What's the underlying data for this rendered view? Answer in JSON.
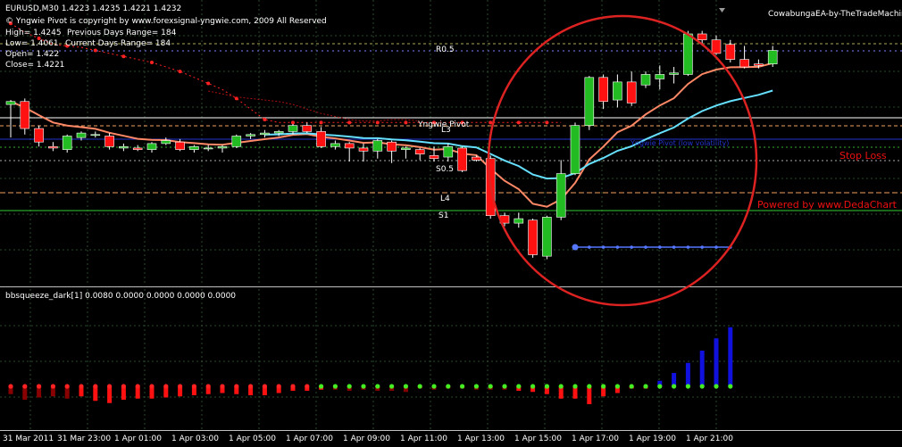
{
  "header": {
    "symbol_line": "EURUSD,M30  1.4223 1.4235 1.4221 1.4232",
    "copyright": "© Yngwie Pivot is copyright by www.forexsignal-yngwie.com, 2009 All Reserved",
    "high": "High= 1.4245",
    "prev_range": "Previous Days Range= 184",
    "low": "Low= 1.4061",
    "current_range": "Current Days Range= 184",
    "open": "Open= 1.422",
    "close": "Close= 1.4221"
  },
  "ea_label": "CowabungaEA-by-TheTradeMachine",
  "pivot_labels": {
    "r05": "R0.5",
    "yngwie_pivot": "Yngwie Pivot",
    "l3": "L3",
    "s05": "S0.5",
    "l4": "L4",
    "s1": "S1"
  },
  "annotations": {
    "stop_loss": "Stop Loss",
    "powered_by": "Powered by www.DedaChart",
    "blue_note": "Yngwie Pivot (low volatility)"
  },
  "indicator": {
    "label": "bbsqueeze_dark[1] 0.0080 0.0000 0.0000 0.0000 0.0000"
  },
  "time_axis": [
    "31 Mar 2011",
    "31 Mar 23:00",
    "1 Apr 01:00",
    "1 Apr 03:00",
    "1 Apr 05:00",
    "1 Apr 07:00",
    "1 Apr 09:00",
    "1 Apr 11:00",
    "1 Apr 13:00",
    "1 Apr 15:00",
    "1 Apr 17:00",
    "1 Apr 19:00",
    "1 Apr 21:00"
  ],
  "colors": {
    "bull": "#22bb22",
    "bear": "#ff1111",
    "squeeze_blue": "#1111dd",
    "squeeze_red": "#ff1111",
    "squeeze_darkred": "#880000",
    "ma_fast": "#ff8866",
    "ma_slow": "#66e0ff",
    "dots_red": "#ff2222",
    "dots_blue": "#5577ff",
    "circle": "#dd2222"
  },
  "chart_data": {
    "type": "candlestick",
    "candles": [
      {
        "o": 1.4196,
        "h": 1.4199,
        "l": 1.4174,
        "c": 1.4198
      },
      {
        "o": 1.4198,
        "h": 1.42,
        "l": 1.4176,
        "c": 1.418
      },
      {
        "o": 1.418,
        "h": 1.4182,
        "l": 1.4168,
        "c": 1.4171
      },
      {
        "o": 1.4168,
        "h": 1.4171,
        "l": 1.4165,
        "c": 1.4167
      },
      {
        "o": 1.4166,
        "h": 1.4176,
        "l": 1.4164,
        "c": 1.4175
      },
      {
        "o": 1.4174,
        "h": 1.4178,
        "l": 1.4172,
        "c": 1.4177
      },
      {
        "o": 1.4176,
        "h": 1.4178,
        "l": 1.4174,
        "c": 1.4176
      },
      {
        "o": 1.4175,
        "h": 1.4177,
        "l": 1.4166,
        "c": 1.4168
      },
      {
        "o": 1.4167,
        "h": 1.417,
        "l": 1.4165,
        "c": 1.4168
      },
      {
        "o": 1.4167,
        "h": 1.4169,
        "l": 1.4165,
        "c": 1.4166
      },
      {
        "o": 1.4166,
        "h": 1.4171,
        "l": 1.4164,
        "c": 1.417
      },
      {
        "o": 1.417,
        "h": 1.4174,
        "l": 1.4169,
        "c": 1.4172
      },
      {
        "o": 1.4171,
        "h": 1.4173,
        "l": 1.4165,
        "c": 1.4166
      },
      {
        "o": 1.4166,
        "h": 1.4169,
        "l": 1.4164,
        "c": 1.4168
      },
      {
        "o": 1.4167,
        "h": 1.4169,
        "l": 1.4165,
        "c": 1.4167
      },
      {
        "o": 1.4167,
        "h": 1.4169,
        "l": 1.4164,
        "c": 1.4168
      },
      {
        "o": 1.4168,
        "h": 1.4176,
        "l": 1.4167,
        "c": 1.4175
      },
      {
        "o": 1.4175,
        "h": 1.4177,
        "l": 1.4173,
        "c": 1.4176
      },
      {
        "o": 1.4176,
        "h": 1.4179,
        "l": 1.4174,
        "c": 1.4177
      },
      {
        "o": 1.4177,
        "h": 1.4179,
        "l": 1.4175,
        "c": 1.4178
      },
      {
        "o": 1.4178,
        "h": 1.4183,
        "l": 1.4176,
        "c": 1.4182
      },
      {
        "o": 1.4182,
        "h": 1.4184,
        "l": 1.4177,
        "c": 1.4178
      },
      {
        "o": 1.4178,
        "h": 1.4181,
        "l": 1.4167,
        "c": 1.4168
      },
      {
        "o": 1.4168,
        "h": 1.4172,
        "l": 1.4166,
        "c": 1.417
      },
      {
        "o": 1.417,
        "h": 1.4171,
        "l": 1.4158,
        "c": 1.4167
      },
      {
        "o": 1.4167,
        "h": 1.417,
        "l": 1.4158,
        "c": 1.4165
      },
      {
        "o": 1.4165,
        "h": 1.4173,
        "l": 1.416,
        "c": 1.4172
      },
      {
        "o": 1.4171,
        "h": 1.4172,
        "l": 1.4157,
        "c": 1.4165
      },
      {
        "o": 1.4166,
        "h": 1.4168,
        "l": 1.416,
        "c": 1.4167
      },
      {
        "o": 1.4166,
        "h": 1.4167,
        "l": 1.4159,
        "c": 1.4163
      },
      {
        "o": 1.4162,
        "h": 1.4168,
        "l": 1.4158,
        "c": 1.416
      },
      {
        "o": 1.4161,
        "h": 1.417,
        "l": 1.4158,
        "c": 1.4168
      },
      {
        "o": 1.4167,
        "h": 1.4168,
        "l": 1.4151,
        "c": 1.4152
      },
      {
        "o": 1.4161,
        "h": 1.4162,
        "l": 1.4158,
        "c": 1.4159
      },
      {
        "o": 1.416,
        "h": 1.4162,
        "l": 1.412,
        "c": 1.4122
      },
      {
        "o": 1.4122,
        "h": 1.4124,
        "l": 1.4115,
        "c": 1.4117
      },
      {
        "o": 1.4117,
        "h": 1.4124,
        "l": 1.4114,
        "c": 1.412
      },
      {
        "o": 1.4119,
        "h": 1.412,
        "l": 1.4094,
        "c": 1.4096
      },
      {
        "o": 1.4095,
        "h": 1.4122,
        "l": 1.4093,
        "c": 1.4121
      },
      {
        "o": 1.4121,
        "h": 1.4159,
        "l": 1.4119,
        "c": 1.415
      },
      {
        "o": 1.415,
        "h": 1.4184,
        "l": 1.4149,
        "c": 1.4182
      },
      {
        "o": 1.4182,
        "h": 1.4215,
        "l": 1.4179,
        "c": 1.4214
      },
      {
        "o": 1.4214,
        "h": 1.4216,
        "l": 1.4193,
        "c": 1.4198
      },
      {
        "o": 1.4199,
        "h": 1.4216,
        "l": 1.4194,
        "c": 1.4211
      },
      {
        "o": 1.4211,
        "h": 1.4218,
        "l": 1.4195,
        "c": 1.4197
      },
      {
        "o": 1.4209,
        "h": 1.4218,
        "l": 1.4207,
        "c": 1.4216
      },
      {
        "o": 1.4213,
        "h": 1.4222,
        "l": 1.4206,
        "c": 1.4216
      },
      {
        "o": 1.4216,
        "h": 1.4221,
        "l": 1.421,
        "c": 1.4217
      },
      {
        "o": 1.4216,
        "h": 1.4245,
        "l": 1.4215,
        "c": 1.4243
      },
      {
        "o": 1.4243,
        "h": 1.4245,
        "l": 1.4236,
        "c": 1.4239
      },
      {
        "o": 1.4239,
        "h": 1.4242,
        "l": 1.4229,
        "c": 1.423
      },
      {
        "o": 1.4236,
        "h": 1.4239,
        "l": 1.4224,
        "c": 1.4226
      },
      {
        "o": 1.4226,
        "h": 1.4235,
        "l": 1.422,
        "c": 1.4221
      },
      {
        "o": 1.4223,
        "h": 1.4226,
        "l": 1.422,
        "c": 1.4222
      },
      {
        "o": 1.4223,
        "h": 1.4235,
        "l": 1.4221,
        "c": 1.4232
      }
    ],
    "squeeze": [
      -0.0007,
      -0.0012,
      -0.001,
      -0.0009,
      -0.0011,
      -0.0009,
      -0.0013,
      -0.0015,
      -0.0012,
      -0.0011,
      -0.0011,
      -0.001,
      -0.0009,
      -0.0008,
      -0.0007,
      -0.0006,
      -0.0007,
      -0.0008,
      -0.0008,
      -0.0006,
      -0.0004,
      -0.0004,
      -0.0003,
      -0.0003,
      -0.0004,
      -0.0003,
      -0.0004,
      -0.0004,
      -0.0005,
      -0.0002,
      -0.0003,
      -0.0002,
      -0.0002,
      -0.0003,
      -0.0003,
      -0.0003,
      -0.0004,
      -0.0005,
      -0.0007,
      -0.0011,
      -0.0011,
      -0.0016,
      -0.0009,
      -0.0006,
      -0.0002,
      -0.0002,
      0.0005,
      0.0012,
      0.0021,
      0.0032,
      0.0043,
      0.0053,
      0.006,
      0.0063,
      0.0063,
      0.0068,
      0.0067,
      0.008
    ],
    "squeeze_dark": [
      1,
      1,
      1,
      1,
      1,
      0,
      0,
      0,
      0,
      0,
      0,
      0,
      0,
      0,
      0,
      0,
      0,
      0,
      0,
      0,
      0,
      0,
      0,
      0,
      0,
      0,
      0,
      0,
      0,
      0,
      0,
      0,
      0,
      0,
      0,
      0,
      0,
      0,
      0,
      0,
      0,
      0,
      0,
      0,
      0,
      0,
      0,
      0,
      0,
      0,
      0,
      0,
      0,
      0,
      0,
      0,
      0,
      0
    ],
    "squeeze_dots": "green from 1 Apr 11:00 onward, red before",
    "pivot_levels": {
      "R0.5": 1.4239,
      "Yngwie Pivot": 1.4184,
      "L3": 1.4178,
      "S0.5": 1.4156,
      "L4": 1.4144,
      "S1": 1.4133
    }
  }
}
